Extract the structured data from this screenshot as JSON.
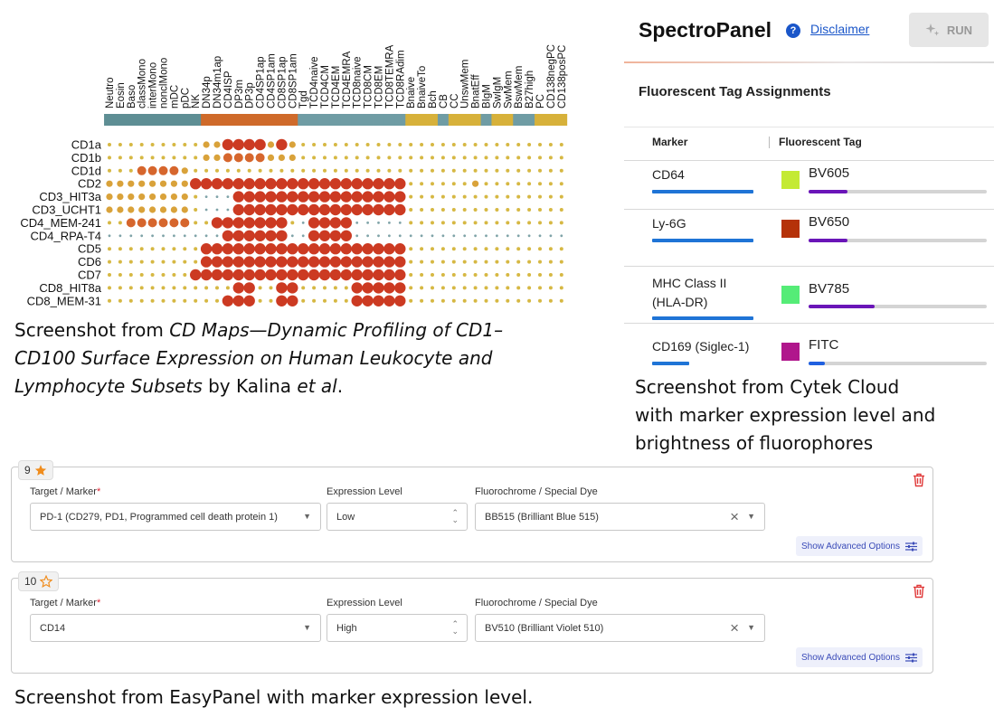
{
  "cdmap": {
    "columns": [
      "Neutro",
      "Eosin",
      "Baso",
      "classMono",
      "interMono",
      "nonclMono",
      "mDC",
      "pDC",
      "NK",
      "DN34p",
      "DN34m1ap",
      "CD4ISP",
      "DP3m",
      "DP3p",
      "CD4SP1ap",
      "CD4SP1am",
      "CD8SP1ap",
      "CD8SP1am",
      "Tgd",
      "TCD4naive",
      "TCD4CM",
      "TCD4EM",
      "TCD4EMRA",
      "TCD8naive",
      "TCD8CM",
      "TCD8EM",
      "TCD8TEMRA",
      "TCD8RAdim",
      "Bnaive",
      "BnaiveTo",
      "Bch",
      "CB",
      "CC",
      "UnswMem",
      "BnatEff",
      "BIgM",
      "SwIgM",
      "SwMem",
      "BswMem",
      "B27high",
      "PC",
      "CD138negPC",
      "CD138posPC"
    ],
    "rows": [
      "CD1a",
      "CD1b",
      "CD1d",
      "CD2",
      "CD3_HIT3a",
      "CD3_UCHT1",
      "CD4_MEM-241",
      "CD4_RPA-T4",
      "CD5",
      "CD6",
      "CD7",
      "CD8_HIT8a",
      "CD8_MEM-31"
    ],
    "band_colors": {
      "myeloid": "#5e8e94",
      "thymocyte": "#cf6a2a",
      "tcell": "#6f9ca4",
      "bcell": "#d7b13a"
    }
  },
  "captions": {
    "cdmap_prefix": "Screenshot from ",
    "cdmap_title": "CD Maps—Dynamic Profiling of CD1–CD100 Surface Expression on Human Leukocyte and Lymphocyte Subsets",
    "cdmap_by": " by Kalina ",
    "cdmap_etal": "et al",
    "cdmap_dot": ".",
    "cytek_line1": "Screenshot from Cytek Cloud",
    "cytek_line2": "with marker expression level and",
    "cytek_line3": "brightness of fluorophores",
    "easypanel": "Screenshot from EasyPanel with marker expression level."
  },
  "spectro": {
    "title": "SpectroPanel",
    "help_glyph": "?",
    "disclaimer": "Disclaimer",
    "run": "RUN",
    "subtitle": "Fluorescent Tag Assignments",
    "col_marker": "Marker",
    "col_tag": "Fluorescent Tag",
    "rows": [
      {
        "marker": "CD64",
        "marker2": "",
        "tag": "BV605",
        "color": "#c4ea34",
        "marker_level": 1.0,
        "brightness": 0.22
      },
      {
        "marker": "Ly-6G",
        "marker2": "",
        "tag": "BV650",
        "color": "#b53209",
        "marker_level": 1.0,
        "brightness": 0.22
      },
      {
        "marker": "MHC Class II",
        "marker2": "(HLA-DR)",
        "tag": "BV785",
        "color": "#55ec77",
        "marker_level": 1.0,
        "brightness": 0.37
      },
      {
        "marker": "CD169 (Siglec-1)",
        "marker2": "",
        "tag": "FITC",
        "color": "#b0168c",
        "marker_level": 0.37,
        "brightness": 0.09
      }
    ]
  },
  "easypanel": {
    "cards": [
      {
        "number": "9",
        "starred": true,
        "target_label": "Target / Marker",
        "required": "*",
        "target": "PD-1 (CD279, PD1, Programmed cell death protein 1)",
        "expr_label": "Expression Level",
        "expr": "Low",
        "fluor_label": "Fluorochrome / Special Dye",
        "fluor": "BB515 (Brilliant Blue 515)",
        "advanced": "Show Advanced Options"
      },
      {
        "number": "10",
        "starred": false,
        "target_label": "Target / Marker",
        "required": "*",
        "target": "CD14",
        "expr_label": "Expression Level",
        "expr": "High",
        "fluor_label": "Fluorochrome / Special Dye",
        "fluor": "BV510 (Brilliant Violet 510)",
        "advanced": "Show Advanced Options"
      }
    ]
  }
}
